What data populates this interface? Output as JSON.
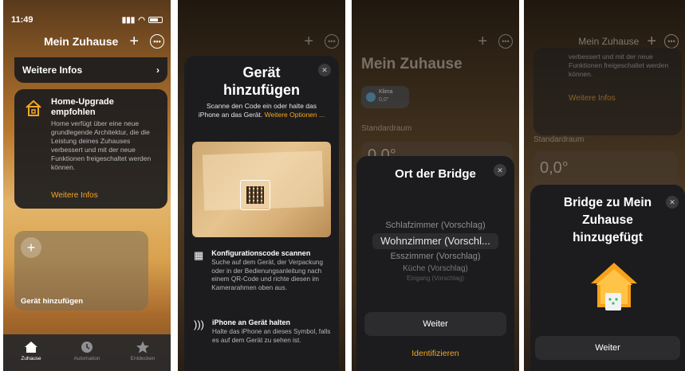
{
  "panel1": {
    "status": {
      "time": "11:49"
    },
    "nav": {
      "title": "Mein Zuhause",
      "add_icon": "plus-icon",
      "more_icon": "ellipsis-circle-icon"
    },
    "infos_row": {
      "label": "Weitere Infos",
      "chevron": "chevron-right-icon"
    },
    "upgrade": {
      "title": "Home-Upgrade empfohlen",
      "body": "Home verfügt über eine neue grundlegende Architektur, die die Leistung deines Zuhauses verbessert und mit der neue Funktionen freigeschaltet werden können.",
      "link": "Weitere Infos",
      "icon": "home-icon"
    },
    "add_tile": {
      "label": "Gerät hinzufügen",
      "icon": "plus-icon"
    },
    "tabs": [
      {
        "label": "Zuhause",
        "icon": "house-icon",
        "active": true
      },
      {
        "label": "Automation",
        "icon": "clock-icon",
        "active": false
      },
      {
        "label": "Entdecken",
        "icon": "star-icon",
        "active": false
      }
    ]
  },
  "panel2": {
    "title_line1": "Gerät",
    "title_line2": "hinzufügen",
    "subtitle": "Scanne den Code ein oder halte das iPhone an das Gerät.",
    "subtitle_link": "Weitere Optionen ...",
    "rows": [
      {
        "icon": "qr-code-icon",
        "title": "Konfigurationscode scannen",
        "text": "Suche auf dem Gerät, der Verpackung oder in der Bedienungsanleitung nach einem QR-Code und richte diesen im Kamerarahmen oben aus."
      },
      {
        "icon": "nfc-icon",
        "title": "iPhone an Gerät halten",
        "text": "Halte das iPhone an dieses Symbol, falls es auf dem Gerät zu sehen ist."
      }
    ]
  },
  "panel3": {
    "bg_title": "Mein Zuhause",
    "klima": {
      "name": "Klima",
      "value": "0,0°"
    },
    "section": "Standardraum",
    "temp": "0,0°",
    "sheet": {
      "title": "Ort der Bridge",
      "options": [
        "Schlafzimmer (Vorschlag)",
        "Wohnzimmer (Vorschl...",
        "Esszimmer (Vorschlag)",
        "Küche (Vorschlag)",
        "Eingang (Vorschlag)"
      ],
      "selected_index": 1,
      "primary_button": "Weiter",
      "secondary_button": "Identifizieren"
    }
  },
  "panel4": {
    "nav_title": "Mein Zuhause",
    "bg_text": "verbessert und mit der neue Funktionen freigeschaltet werden können.",
    "bg_link": "Weitere Infos",
    "section": "Standardraum",
    "temp": "0,0°",
    "sheet": {
      "title": "Bridge zu Mein Zuhause hinzugefügt",
      "icon": "home-bridge-icon",
      "primary_button": "Weiter"
    }
  },
  "colors": {
    "accent": "#f5a623",
    "sheet": "#1c1c1e",
    "button": "#2c2c2e"
  }
}
